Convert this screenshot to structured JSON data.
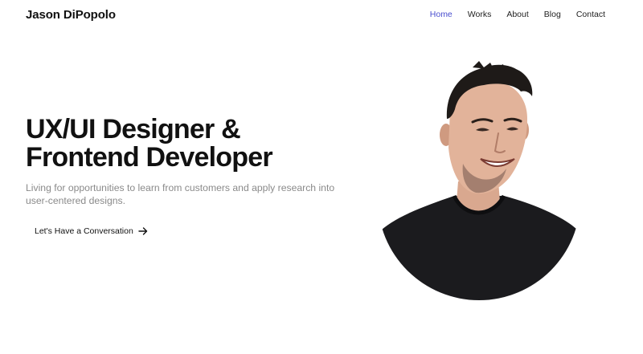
{
  "header": {
    "logo": "Jason DiPopolo",
    "nav": [
      {
        "label": "Home",
        "active": true
      },
      {
        "label": "Works",
        "active": false
      },
      {
        "label": "About",
        "active": false
      },
      {
        "label": "Blog",
        "active": false
      },
      {
        "label": "Contact",
        "active": false
      }
    ]
  },
  "hero": {
    "headline_line1": "UX/UI Designer &",
    "headline_line2": "Frontend Developer",
    "subtitle": "Living for opportunities to learn from customers and apply research into user-centered designs.",
    "cta_label": "Let's Have a Conversation",
    "cta_icon": "arrow-right-icon"
  },
  "colors": {
    "accent": "#4a4fcf",
    "text": "#111111",
    "muted": "#8a8a8a",
    "shirt": "#1b1b1e",
    "background": "#ffffff"
  }
}
